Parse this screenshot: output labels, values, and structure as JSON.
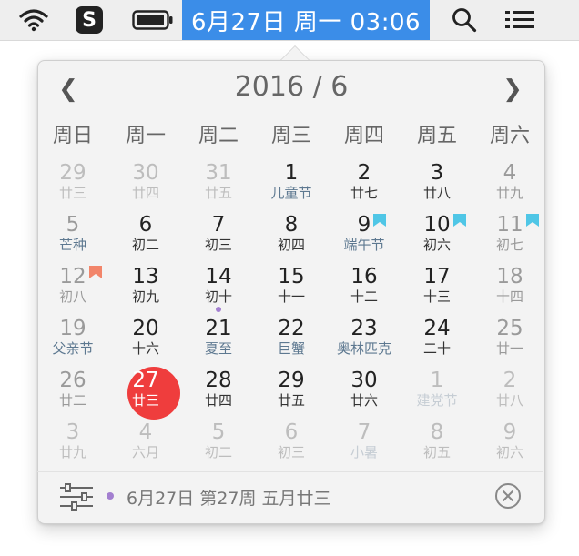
{
  "menubar": {
    "clock_text": "6月27日 周一 03:06",
    "sogou_glyph": "S",
    "icons": [
      "wifi-icon",
      "sogou-input-icon",
      "battery-icon",
      "search-icon",
      "list-icon"
    ]
  },
  "calendar": {
    "title": "2016 / 6",
    "prev_glyph": "❮",
    "next_glyph": "❯",
    "weekdays": [
      "周日",
      "周一",
      "周二",
      "周三",
      "周四",
      "周五",
      "周六"
    ],
    "accent_today": "#ef3d3d",
    "flag_colors": {
      "holiday": "#4fc6e6",
      "workday": "#f2856a"
    },
    "event_dot_color": "#a37fd0",
    "weeks": [
      [
        {
          "day": "29",
          "sub": "廿三",
          "state": "other"
        },
        {
          "day": "30",
          "sub": "廿四",
          "state": "other"
        },
        {
          "day": "31",
          "sub": "廿五",
          "state": "other"
        },
        {
          "day": "1",
          "sub": "儿童节",
          "state": "normal",
          "festival": true
        },
        {
          "day": "2",
          "sub": "廿七",
          "state": "normal"
        },
        {
          "day": "3",
          "sub": "廿八",
          "state": "normal"
        },
        {
          "day": "4",
          "sub": "廿九",
          "state": "weekend"
        }
      ],
      [
        {
          "day": "5",
          "sub": "芒种",
          "state": "weekend",
          "festival": true
        },
        {
          "day": "6",
          "sub": "初二",
          "state": "normal"
        },
        {
          "day": "7",
          "sub": "初三",
          "state": "normal"
        },
        {
          "day": "8",
          "sub": "初四",
          "state": "normal"
        },
        {
          "day": "9",
          "sub": "端午节",
          "state": "normal",
          "festival": true,
          "flag": "holiday"
        },
        {
          "day": "10",
          "sub": "初六",
          "state": "normal",
          "flag": "holiday"
        },
        {
          "day": "11",
          "sub": "初七",
          "state": "weekend",
          "flag": "holiday"
        }
      ],
      [
        {
          "day": "12",
          "sub": "初八",
          "state": "weekend",
          "flag": "workday"
        },
        {
          "day": "13",
          "sub": "初九",
          "state": "normal"
        },
        {
          "day": "14",
          "sub": "初十",
          "state": "normal",
          "event": true
        },
        {
          "day": "15",
          "sub": "十一",
          "state": "normal"
        },
        {
          "day": "16",
          "sub": "十二",
          "state": "normal"
        },
        {
          "day": "17",
          "sub": "十三",
          "state": "normal"
        },
        {
          "day": "18",
          "sub": "十四",
          "state": "weekend"
        }
      ],
      [
        {
          "day": "19",
          "sub": "父亲节",
          "state": "weekend",
          "festival": true
        },
        {
          "day": "20",
          "sub": "十六",
          "state": "normal"
        },
        {
          "day": "21",
          "sub": "夏至",
          "state": "normal",
          "festival": true
        },
        {
          "day": "22",
          "sub": "巨蟹",
          "state": "normal",
          "festival": true
        },
        {
          "day": "23",
          "sub": "奥林匹克",
          "state": "normal",
          "festival": true
        },
        {
          "day": "24",
          "sub": "二十",
          "state": "normal"
        },
        {
          "day": "25",
          "sub": "廿一",
          "state": "weekend"
        }
      ],
      [
        {
          "day": "26",
          "sub": "廿二",
          "state": "weekend"
        },
        {
          "day": "27",
          "sub": "廿三",
          "state": "today"
        },
        {
          "day": "28",
          "sub": "廿四",
          "state": "normal"
        },
        {
          "day": "29",
          "sub": "廿五",
          "state": "normal"
        },
        {
          "day": "30",
          "sub": "廿六",
          "state": "normal"
        },
        {
          "day": "1",
          "sub": "建党节",
          "state": "other",
          "festival": true
        },
        {
          "day": "2",
          "sub": "廿八",
          "state": "other"
        }
      ],
      [
        {
          "day": "3",
          "sub": "廿九",
          "state": "other"
        },
        {
          "day": "4",
          "sub": "六月",
          "state": "other"
        },
        {
          "day": "5",
          "sub": "初二",
          "state": "other"
        },
        {
          "day": "6",
          "sub": "初三",
          "state": "other"
        },
        {
          "day": "7",
          "sub": "小暑",
          "state": "other",
          "festival": true
        },
        {
          "day": "8",
          "sub": "初五",
          "state": "other"
        },
        {
          "day": "9",
          "sub": "初六",
          "state": "other"
        }
      ]
    ]
  },
  "footer": {
    "info": "6月27日 第27周 五月廿三"
  }
}
